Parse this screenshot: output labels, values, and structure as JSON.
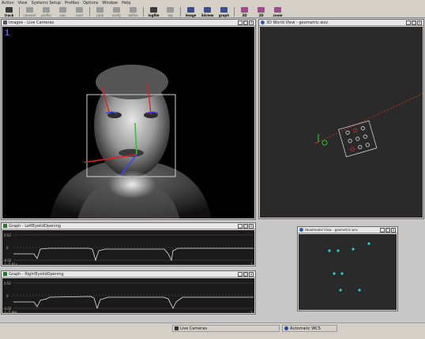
{
  "menu": [
    "Action",
    "View",
    "Systems Setup",
    "Profiles",
    "Options",
    "Window",
    "Help"
  ],
  "toolbar": [
    {
      "label": "track",
      "active": true,
      "icon": "eye-icon"
    },
    {
      "label": "connect",
      "active": false,
      "icon": "connect-icon"
    },
    {
      "label": "profile",
      "active": false,
      "icon": "profile-icon"
    },
    {
      "label": "calc",
      "active": false,
      "icon": "calc-icon"
    },
    {
      "label": "load",
      "active": false,
      "icon": "load-icon"
    },
    {
      "label": "calib",
      "active": false,
      "icon": "calib-icon"
    },
    {
      "label": "verify",
      "active": false,
      "icon": "verify-icon"
    },
    {
      "label": "define",
      "active": false,
      "icon": "define-icon"
    },
    {
      "label": "logfile",
      "active": true,
      "icon": "logfile-icon"
    },
    {
      "label": "log",
      "active": false,
      "icon": "log-icon"
    },
    {
      "label": "image",
      "active": true,
      "icon": "image-icon"
    },
    {
      "label": "3dview",
      "active": true,
      "icon": "3dview-icon"
    },
    {
      "label": "graph",
      "active": true,
      "icon": "graph-icon"
    },
    {
      "label": "3D",
      "active": true,
      "icon": "3d-icon"
    },
    {
      "label": "2D",
      "active": true,
      "icon": "2d-icon"
    },
    {
      "label": "zoom",
      "active": true,
      "icon": "zoom-icon"
    }
  ],
  "windows": {
    "images": {
      "title": "Images - Live Cameras",
      "camera_index": "1"
    },
    "world": {
      "title": "3D World View - geometric.wsv"
    },
    "headmodel": {
      "title": "Headmodel View - geometric.wsv"
    },
    "graph_left": {
      "title": "Graph - LeftEyelidOpening",
      "y_top": "0.02",
      "y_mid": "0",
      "y_bottom": "-0.02",
      "footer_left": "t=5.81s",
      "footer_right": "1"
    },
    "graph_right": {
      "title": "Graph - RightEyelidOpening",
      "y_top": "0.02",
      "y_mid": "0",
      "y_bottom": "-0.02",
      "footer_left": "t=5.99s",
      "footer_right": "1"
    }
  },
  "status": {
    "source": "Live Cameras",
    "wcs": "Automatic WCS"
  },
  "colors": {
    "accent_blue": "#2a5cb0",
    "graph_bg": "#1a1a1a",
    "headmodel_dot": "#22d3d8",
    "overlay_red": "#e02020",
    "overlay_green": "#22cc22",
    "overlay_blue": "#3344ff"
  },
  "window_buttons": {
    "min": "_",
    "max": "□",
    "close": "x"
  }
}
